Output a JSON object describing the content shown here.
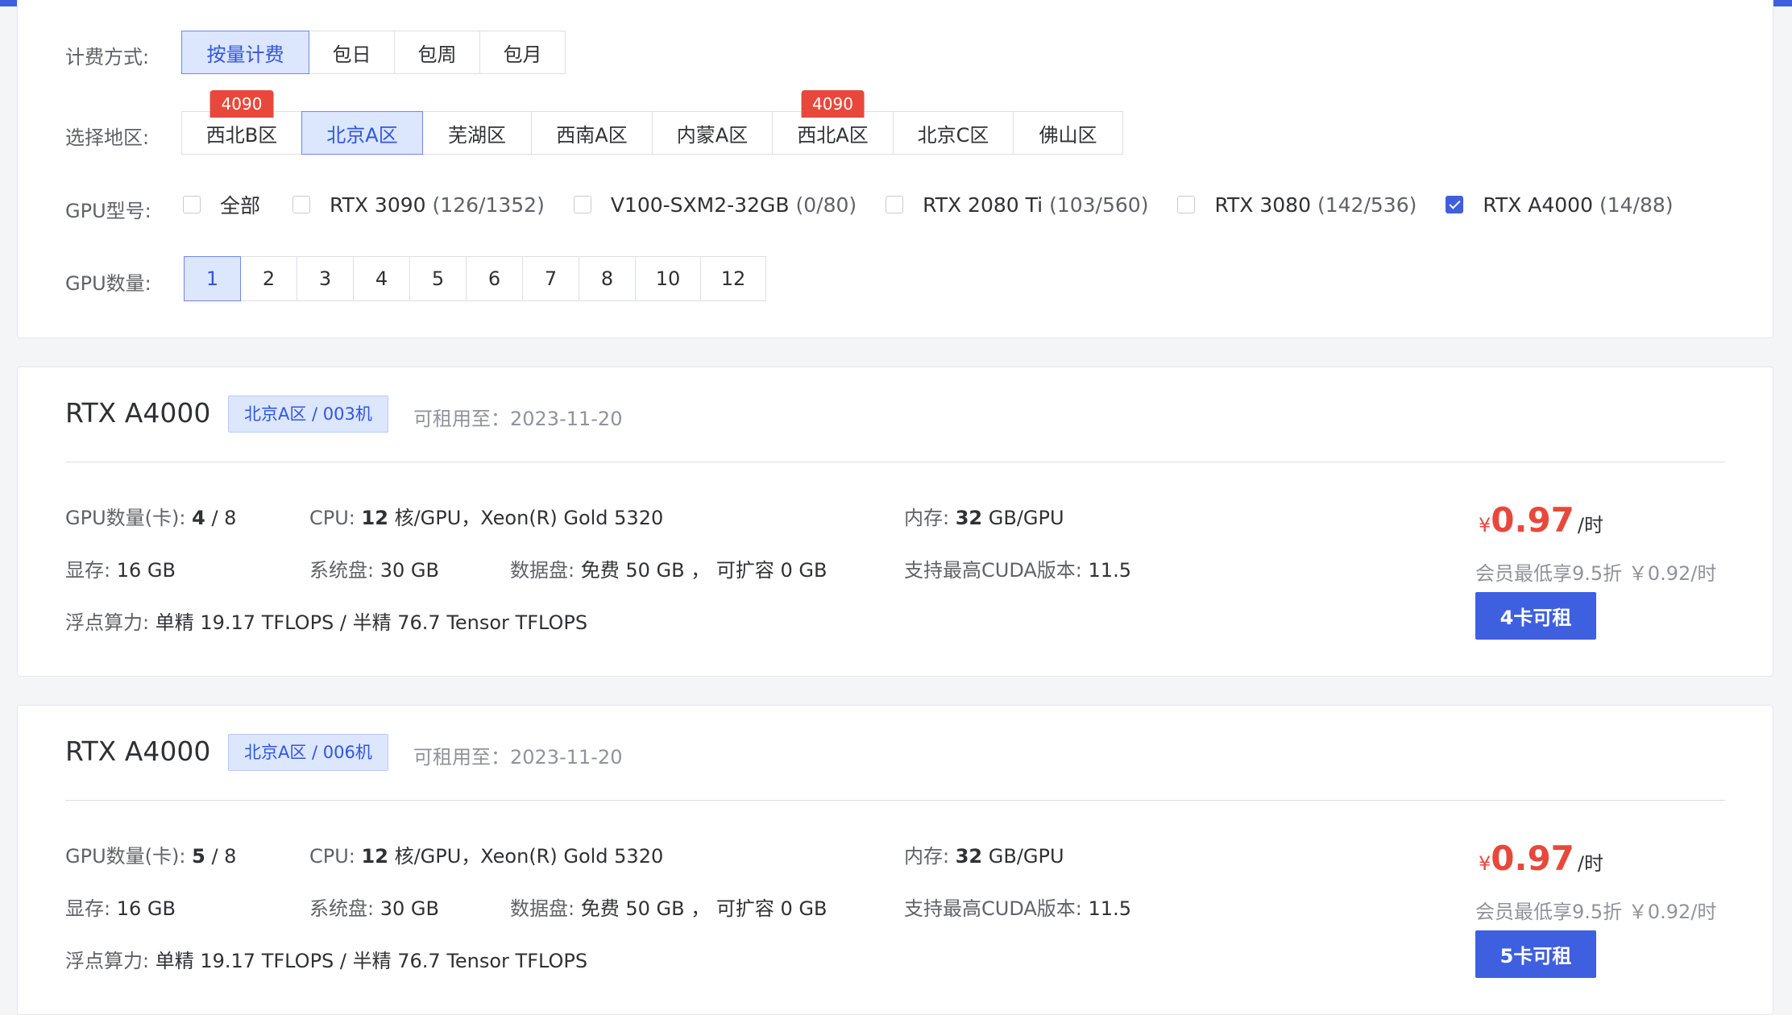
{
  "filters": {
    "billing": {
      "label": "计费方式:",
      "options": [
        {
          "label": "按量计费",
          "active": true
        },
        {
          "label": "包日",
          "active": false
        },
        {
          "label": "包周",
          "active": false
        },
        {
          "label": "包月",
          "active": false
        }
      ]
    },
    "region": {
      "label": "选择地区:",
      "options": [
        {
          "label": "西北B区",
          "active": false,
          "badge": "4090"
        },
        {
          "label": "北京A区",
          "active": true
        },
        {
          "label": "芜湖区",
          "active": false
        },
        {
          "label": "西南A区",
          "active": false
        },
        {
          "label": "内蒙A区",
          "active": false
        },
        {
          "label": "西北A区",
          "active": false,
          "badge": "4090"
        },
        {
          "label": "北京C区",
          "active": false
        },
        {
          "label": "佛山区",
          "active": false
        }
      ]
    },
    "gpu_type": {
      "label": "GPU型号:",
      "options": [
        {
          "name": "全部",
          "count": "",
          "checked": false
        },
        {
          "name": "RTX 3090",
          "count": "(126/1352)",
          "checked": false
        },
        {
          "name": "V100-SXM2-32GB",
          "count": "(0/80)",
          "checked": false
        },
        {
          "name": "RTX 2080 Ti",
          "count": "(103/560)",
          "checked": false
        },
        {
          "name": "RTX 3080",
          "count": "(142/536)",
          "checked": false
        },
        {
          "name": "RTX A4000",
          "count": "(14/88)",
          "checked": true
        }
      ]
    },
    "gpu_count": {
      "label": "GPU数量:",
      "options": [
        {
          "label": "1",
          "active": true
        },
        {
          "label": "2",
          "active": false
        },
        {
          "label": "3",
          "active": false
        },
        {
          "label": "4",
          "active": false
        },
        {
          "label": "5",
          "active": false
        },
        {
          "label": "6",
          "active": false
        },
        {
          "label": "7",
          "active": false
        },
        {
          "label": "8",
          "active": false
        },
        {
          "label": "10",
          "active": false
        },
        {
          "label": "12",
          "active": false
        }
      ]
    }
  },
  "machines": [
    {
      "title": "RTX A4000",
      "tag": "北京A区 / 003机",
      "available": "可租用至：2023-11-20",
      "gpu_count_label": "GPU数量(卡):",
      "gpu_free": "4",
      "gpu_total": "/ 8",
      "cpu_label": "CPU:",
      "cpu_cores": "12",
      "cpu_rest": "核/GPU，Xeon(R) Gold 5320",
      "mem_label": "内存:",
      "mem_value": "32",
      "mem_unit": "GB/GPU",
      "vram_label": "显存:",
      "vram_value": "16 GB",
      "sysdisk_label": "系统盘:",
      "sysdisk_value": "30 GB",
      "datadisk_label": "数据盘:",
      "datadisk_value": "免费 50 GB ， 可扩容 0 GB",
      "cuda_label": "支持最高CUDA版本:",
      "cuda_value": "11.5",
      "flops_label": "浮点算力:",
      "flops_value": "单精 19.17 TFLOPS / 半精 76.7 Tensor TFLOPS",
      "currency": "¥",
      "price": "0.97",
      "unit": "/时",
      "member": "会员最低享9.5折 ￥0.92/时",
      "button": "4卡可租"
    },
    {
      "title": "RTX A4000",
      "tag": "北京A区 / 006机",
      "available": "可租用至：2023-11-20",
      "gpu_count_label": "GPU数量(卡):",
      "gpu_free": "5",
      "gpu_total": "/ 8",
      "cpu_label": "CPU:",
      "cpu_cores": "12",
      "cpu_rest": "核/GPU，Xeon(R) Gold 5320",
      "mem_label": "内存:",
      "mem_value": "32",
      "mem_unit": "GB/GPU",
      "vram_label": "显存:",
      "vram_value": "16 GB",
      "sysdisk_label": "系统盘:",
      "sysdisk_value": "30 GB",
      "datadisk_label": "数据盘:",
      "datadisk_value": "免费 50 GB ， 可扩容 0 GB",
      "cuda_label": "支持最高CUDA版本:",
      "cuda_value": "11.5",
      "flops_label": "浮点算力:",
      "flops_value": "单精 19.17 TFLOPS / 半精 76.7 Tensor TFLOPS",
      "currency": "¥",
      "price": "0.97",
      "unit": "/时",
      "member": "会员最低享9.5折 ￥0.92/时",
      "button": "5卡可租"
    }
  ]
}
